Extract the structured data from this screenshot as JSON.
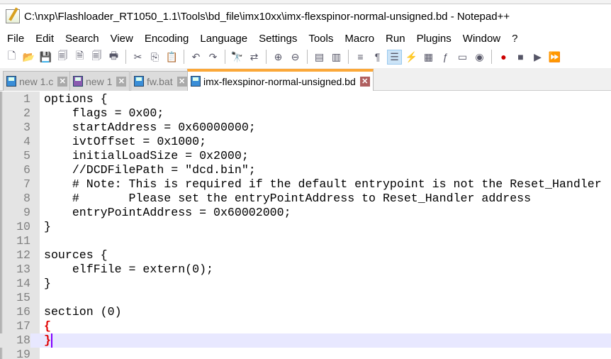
{
  "window": {
    "title": "C:\\nxp\\Flashloader_RT1050_1.1\\Tools\\bd_file\\imx10xx\\imx-flexspinor-normal-unsigned.bd - Notepad++"
  },
  "menu": [
    "File",
    "Edit",
    "Search",
    "View",
    "Encoding",
    "Language",
    "Settings",
    "Tools",
    "Macro",
    "Run",
    "Plugins",
    "Window",
    "?"
  ],
  "tabs": [
    {
      "label": "new 1.c"
    },
    {
      "label": "new 1"
    },
    {
      "label": "fw.bat"
    },
    {
      "label": "imx-flexspinor-normal-unsigned.bd"
    }
  ],
  "editor": {
    "lines": [
      "options {",
      "    flags = 0x00;",
      "    startAddress = 0x60000000;",
      "    ivtOffset = 0x1000;",
      "    initialLoadSize = 0x2000;",
      "    //DCDFilePath = \"dcd.bin\";",
      "    # Note: This is required if the default entrypoint is not the Reset_Handler",
      "    #       Please set the entryPointAddress to Reset_Handler address",
      "    entryPointAddress = 0x60002000;",
      "}",
      "",
      "sources {",
      "    elfFile = extern(0);",
      "}",
      "",
      "section (0)",
      "{",
      "}",
      ""
    ],
    "current_line": 18
  }
}
